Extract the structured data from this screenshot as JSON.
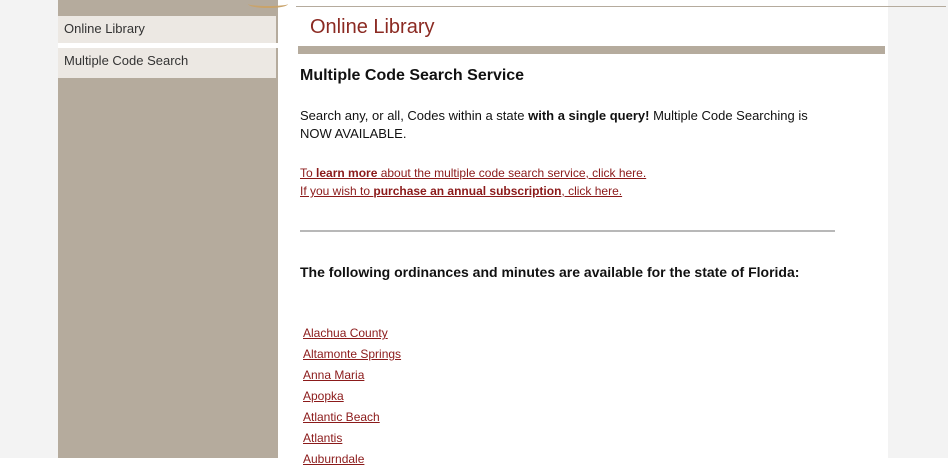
{
  "sidebar": {
    "items": [
      {
        "label": "Online Library"
      },
      {
        "label": "Multiple Code Search"
      }
    ]
  },
  "header": {
    "title": "Online Library"
  },
  "main": {
    "section_title": "Multiple Code Search Service",
    "intro_part1": "Search any, or all, Codes within a state ",
    "intro_bold": "with a single query!",
    "intro_part2": "  Multiple Code Searching is NOW AVAILABLE.",
    "learn_link": {
      "prefix": "To ",
      "bold": "learn more",
      "suffix": " about the multiple code search service, click here."
    },
    "purchase_link": {
      "prefix": "If you wish to ",
      "bold": "purchase an annual subscription",
      "suffix": ", click here."
    },
    "available_heading": "The following ordinances and minutes are available for the state of Florida:",
    "places": [
      "Alachua County",
      "Altamonte Springs",
      "Anna Maria",
      "Apopka",
      "Atlantic Beach",
      "Atlantis",
      "Auburndale"
    ]
  },
  "colors": {
    "accent": "#8b2a22",
    "sidebar_bg": "#b5ab9d",
    "link": "#8b1a1a"
  }
}
